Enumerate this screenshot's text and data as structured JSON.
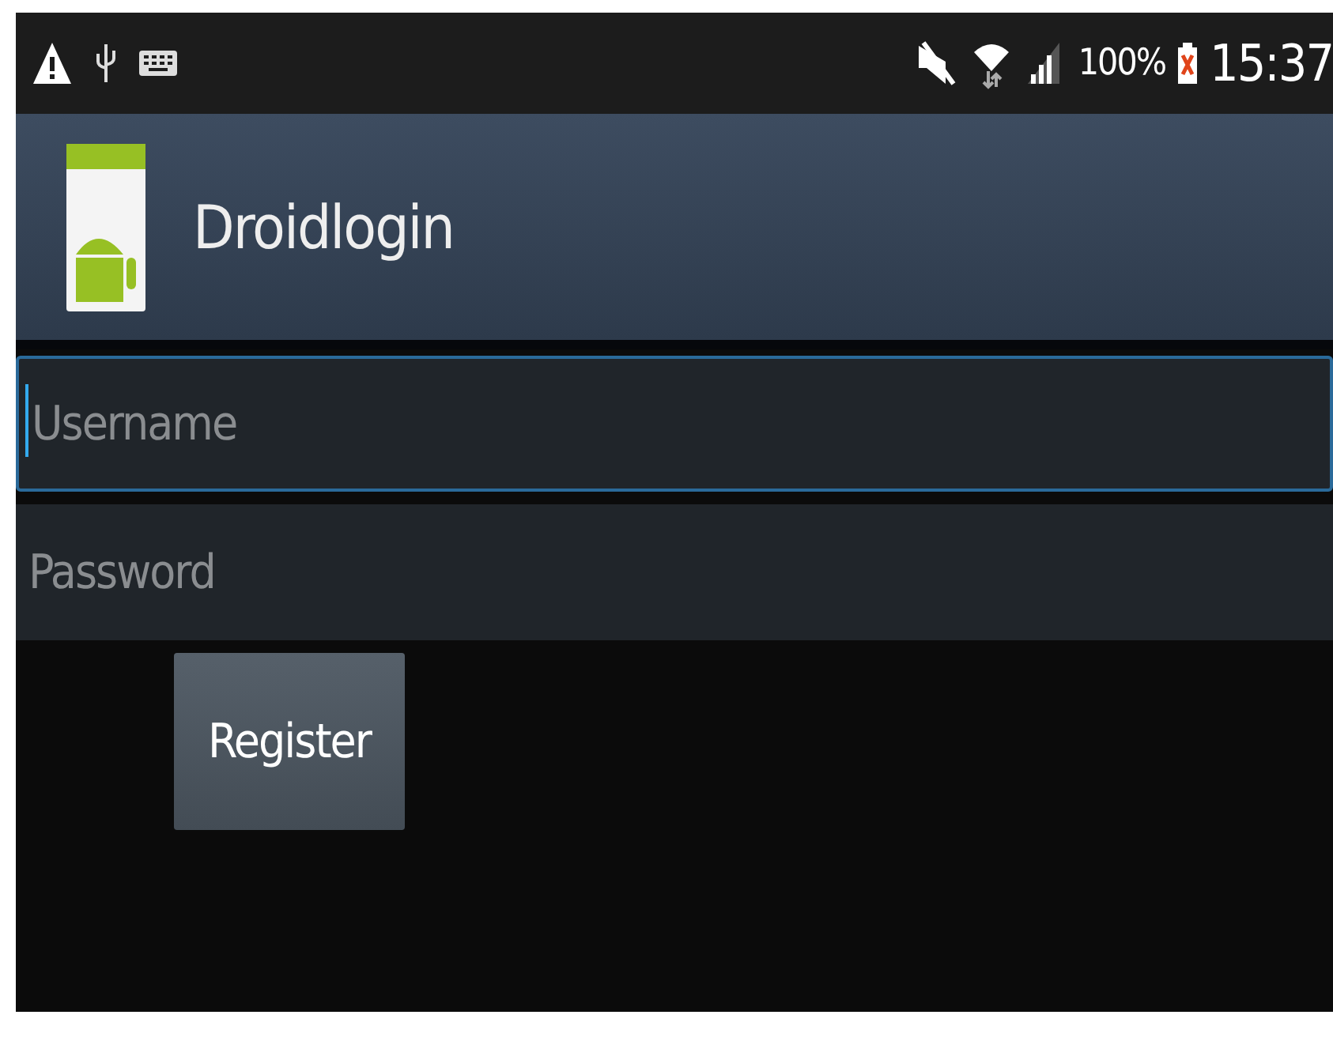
{
  "status_bar": {
    "battery": "100%",
    "time": "15:37"
  },
  "action_bar": {
    "title": "Droidlogin"
  },
  "fields": [
    {
      "placeholder": "Username",
      "focused": true
    },
    {
      "placeholder": "Password",
      "focused": false
    }
  ],
  "buttons": [
    "Register"
  ]
}
